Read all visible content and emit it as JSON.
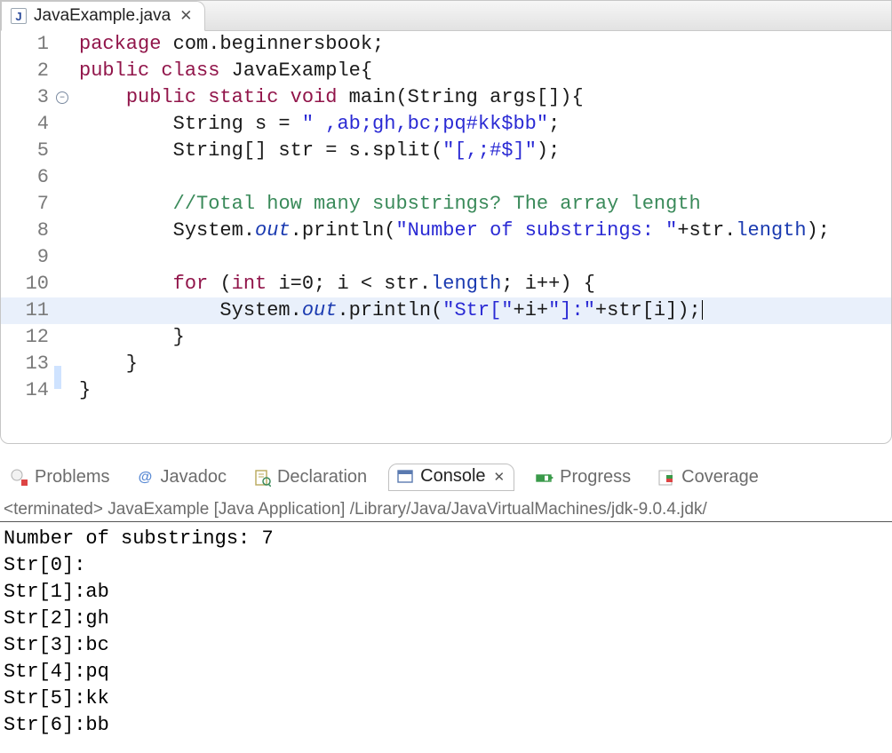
{
  "editor": {
    "tab": {
      "label": "JavaExample.java"
    },
    "lines": [
      {
        "n": "1",
        "marker": "",
        "tokens": [
          [
            "keyword",
            "package "
          ],
          [
            "default",
            "com.beginnersbook;"
          ]
        ]
      },
      {
        "n": "2",
        "marker": "",
        "tokens": [
          [
            "keyword",
            "public class "
          ],
          [
            "default",
            "JavaExample{"
          ]
        ]
      },
      {
        "n": "3",
        "marker": "fold",
        "tokens": [
          [
            "default",
            "    "
          ],
          [
            "keyword",
            "public static void "
          ],
          [
            "default",
            "main(String args[]){"
          ]
        ]
      },
      {
        "n": "4",
        "marker": "",
        "tokens": [
          [
            "default",
            "        String s = "
          ],
          [
            "string",
            "\" ,ab;gh,bc;pq#kk$bb\""
          ],
          [
            "default",
            ";"
          ]
        ]
      },
      {
        "n": "5",
        "marker": "",
        "tokens": [
          [
            "default",
            "        String[] str = s.split("
          ],
          [
            "string",
            "\"[,;#$]\""
          ],
          [
            "default",
            ");"
          ]
        ]
      },
      {
        "n": "6",
        "marker": "",
        "tokens": []
      },
      {
        "n": "7",
        "marker": "",
        "tokens": [
          [
            "default",
            "        "
          ],
          [
            "comment",
            "//Total how many substrings? The array length"
          ]
        ]
      },
      {
        "n": "8",
        "marker": "",
        "tokens": [
          [
            "default",
            "        System."
          ],
          [
            "static",
            "out"
          ],
          [
            "default",
            ".println("
          ],
          [
            "string",
            "\"Number of substrings: \""
          ],
          [
            "default",
            "+str."
          ],
          [
            "field",
            "length"
          ],
          [
            "default",
            ");"
          ]
        ]
      },
      {
        "n": "9",
        "marker": "",
        "tokens": []
      },
      {
        "n": "10",
        "marker": "",
        "tokens": [
          [
            "default",
            "        "
          ],
          [
            "keyword",
            "for "
          ],
          [
            "default",
            "("
          ],
          [
            "keyword",
            "int "
          ],
          [
            "default",
            "i=0; i < str."
          ],
          [
            "field",
            "length"
          ],
          [
            "default",
            "; i++) {"
          ]
        ]
      },
      {
        "n": "11",
        "marker": "",
        "hl": true,
        "cursor": true,
        "tokens": [
          [
            "default",
            "            System."
          ],
          [
            "static",
            "out"
          ],
          [
            "default",
            ".println("
          ],
          [
            "string",
            "\"Str[\""
          ],
          [
            "default",
            "+i+"
          ],
          [
            "string",
            "\"]:\""
          ],
          [
            "default",
            "+str[i]);"
          ]
        ]
      },
      {
        "n": "12",
        "marker": "",
        "tokens": [
          [
            "default",
            "        }"
          ]
        ]
      },
      {
        "n": "13",
        "marker": "blue",
        "tokens": [
          [
            "default",
            "    }"
          ]
        ]
      },
      {
        "n": "14",
        "marker": "",
        "tokens": [
          [
            "default",
            "}"
          ]
        ]
      }
    ]
  },
  "views": {
    "problems": "Problems",
    "javadoc": "Javadoc",
    "declaration": "Declaration",
    "console": "Console",
    "progress": "Progress",
    "coverage": "Coverage"
  },
  "console": {
    "status": "<terminated> JavaExample [Java Application] /Library/Java/JavaVirtualMachines/jdk-9.0.4.jdk/",
    "output": [
      "Number of substrings: 7",
      "Str[0]:",
      "Str[1]:ab",
      "Str[2]:gh",
      "Str[3]:bc",
      "Str[4]:pq",
      "Str[5]:kk",
      "Str[6]:bb"
    ]
  }
}
